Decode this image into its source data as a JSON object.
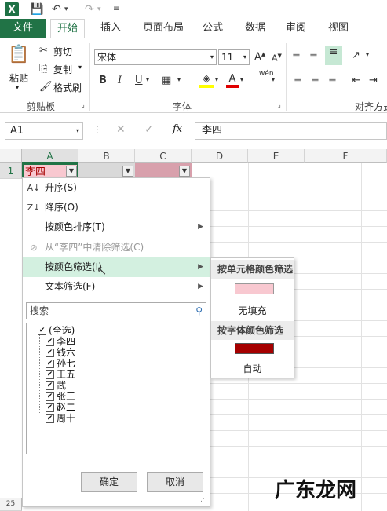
{
  "colors": {
    "excel_green": "#217346",
    "pink": "#f8c8d0",
    "dark_red": "#a50000",
    "hover": "#d3f0e0"
  },
  "title_bar": {
    "quick_access": [
      "save-icon",
      "undo-icon",
      "redo-icon",
      "customize-icon"
    ]
  },
  "tabs": {
    "file": "文件",
    "home": "开始",
    "insert": "插入",
    "page_layout": "页面布局",
    "formulas": "公式",
    "data": "数据",
    "review": "审阅",
    "view": "视图"
  },
  "ribbon": {
    "paste": "粘贴",
    "cut": "剪切",
    "copy": "复制",
    "format_painter": "格式刷",
    "clipboard_label": "剪贴板",
    "font_name": "宋体",
    "font_size": "11",
    "font_label": "字体",
    "align_label": "对齐方式",
    "bold": "B",
    "italic": "I",
    "underline": "U",
    "wen": "wén"
  },
  "formula_bar": {
    "name_box": "A1",
    "formula": "李四",
    "cancel": "✕",
    "enter": "✓",
    "fx": "fx"
  },
  "grid": {
    "columns": [
      "A",
      "B",
      "C",
      "D",
      "E",
      "F"
    ],
    "row1": "1",
    "cell_a1": "李四",
    "row_last": "25"
  },
  "menu": {
    "sort_asc": "升序(S)",
    "sort_desc": "降序(O)",
    "sort_by_color": "按颜色排序(T)",
    "clear_filter": "从“李四”中清除筛选(C)",
    "filter_by_color": "按颜色筛选(I)",
    "text_filter": "文本筛选(F)",
    "search_placeholder": "搜索",
    "items": [
      "(全选)",
      "李四",
      "钱六",
      "孙七",
      "王五",
      "武一",
      "张三",
      "赵二",
      "周十"
    ],
    "ok": "确定",
    "cancel": "取消"
  },
  "submenu": {
    "cell_color_header": "按单元格颜色筛选",
    "no_fill": "无填充",
    "font_color_header": "按字体颜色筛选",
    "auto": "自动"
  },
  "watermark": "广东龙网"
}
